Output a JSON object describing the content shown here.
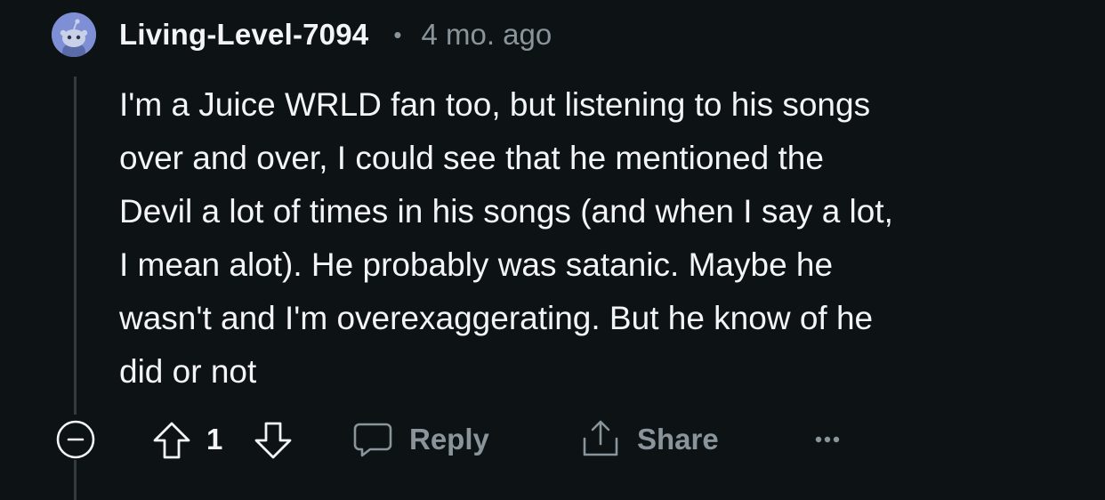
{
  "comment": {
    "username": "Living-Level-7094",
    "separator": "•",
    "timestamp": "4 mo. ago",
    "body_lines": [
      "I'm a Juice WRLD fan too, but listening to his songs",
      "over and over, I could see that he mentioned the",
      "Devil a lot of times in his songs (and when I say a lot,",
      "I mean alot). He probably was satanic. Maybe he",
      "wasn't and I'm overexaggerating. But he know of he",
      "did or not"
    ],
    "score": "1",
    "reply_label": "Reply",
    "share_label": "Share"
  },
  "icons": {
    "avatar": "snoo-avatar",
    "collapse": "collapse-minus-icon",
    "upvote": "upvote-arrow-icon",
    "downvote": "downvote-arrow-icon",
    "reply": "speech-bubble-icon",
    "share": "share-upload-icon",
    "more": "more-dots-icon"
  },
  "colors": {
    "background": "#0d1214",
    "text_primary": "#f2f4f5",
    "text_secondary": "#8a949b",
    "thread_line": "#343a3d",
    "avatar_bg": "#7e8fd6"
  }
}
